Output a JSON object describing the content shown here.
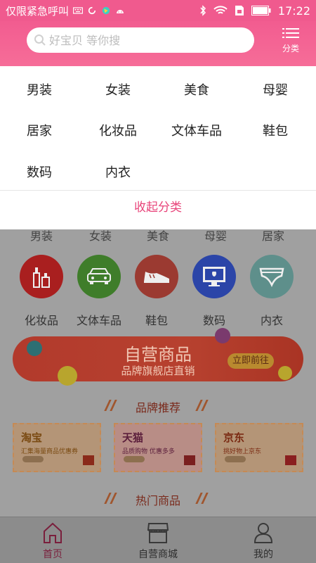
{
  "status_bar": {
    "carrier_text": "仅限紧急呼叫",
    "time": "17:22"
  },
  "search": {
    "placeholder": "好宝贝 等你搜"
  },
  "category_button": {
    "label": "分类"
  },
  "dropdown": {
    "items": [
      "男装",
      "女装",
      "美食",
      "母婴",
      "居家",
      "化妆品",
      "文体车品",
      "鞋包",
      "数码",
      "内衣"
    ],
    "collapse_label": "收起分类"
  },
  "page": {
    "partial_row": [
      "男装",
      "女装",
      "美食",
      "母婴",
      "居家"
    ],
    "category_icons": [
      {
        "label": "化妆品",
        "icon": "cosmetics-icon",
        "color": "#a91f1f"
      },
      {
        "label": "文体车品",
        "icon": "car-icon",
        "color": "#3f7d2a"
      },
      {
        "label": "鞋包",
        "icon": "shoe-icon",
        "color": "#9b3a31"
      },
      {
        "label": "数码",
        "icon": "computer-icon",
        "color": "#2b45a8"
      },
      {
        "label": "内衣",
        "icon": "underwear-icon",
        "color": "#5e8f8b"
      }
    ],
    "banner": {
      "title": "自营商品",
      "subtitle": "品牌旗舰店直销",
      "button": "立即前往"
    },
    "brand_section_title": "品牌推荐",
    "brands": [
      {
        "name": "淘宝",
        "desc": "汇集海量商品优惠券",
        "logo_text": "淘"
      },
      {
        "name": "天猫",
        "desc": "品质购物 优惠多多",
        "logo_text": "天猫"
      },
      {
        "name": "京东",
        "desc": "挑好物上京东",
        "logo_text": "京"
      }
    ],
    "hot_section_title": "热门商品"
  },
  "tabbar": {
    "tabs": [
      {
        "label": "首页",
        "icon": "home-icon"
      },
      {
        "label": "自营商城",
        "icon": "store-icon"
      },
      {
        "label": "我的",
        "icon": "user-icon"
      }
    ]
  },
  "colors": {
    "brand_pink": "#f05a8e",
    "collapse_text": "#e8447a"
  }
}
